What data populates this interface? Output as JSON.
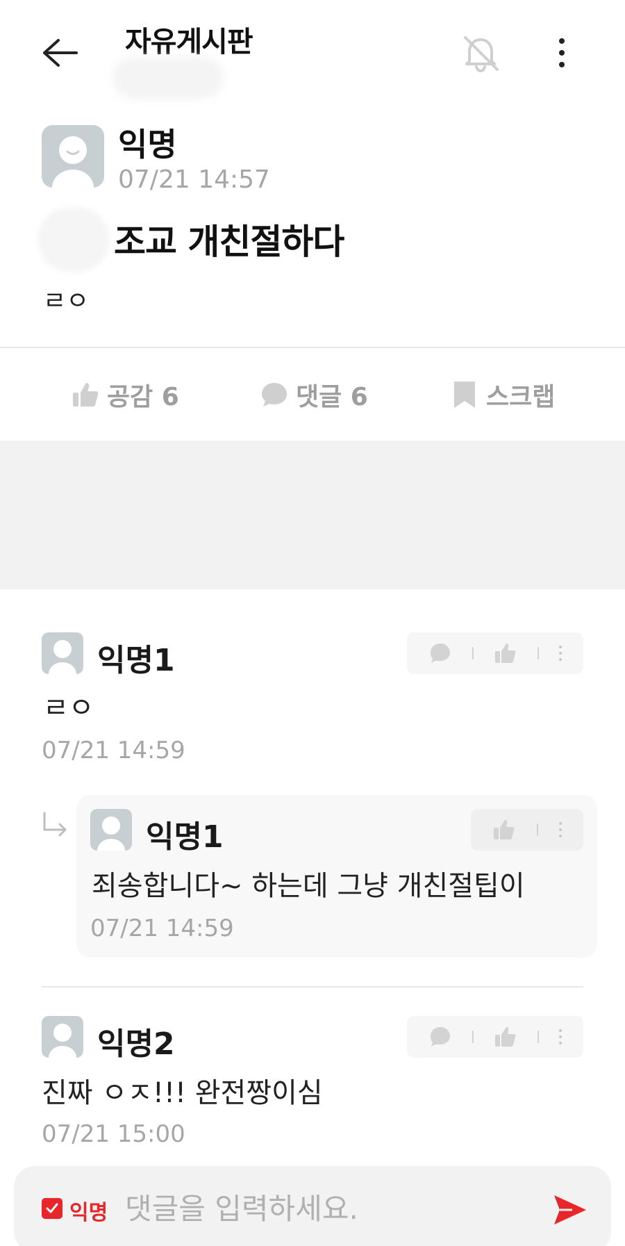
{
  "header": {
    "board_title": "자유게시판"
  },
  "post": {
    "author": "익명",
    "time": "07/21 14:57",
    "title": "조교 개친절하다",
    "body": "ㄹㅇ",
    "actions": {
      "like_label": "공감 6",
      "comment_label": "댓글 6",
      "scrap_label": "스크랩"
    }
  },
  "comments": [
    {
      "author": "익명1",
      "body": "ㄹㅇ",
      "time": "07/21 14:59"
    },
    {
      "author": "익명2",
      "body": "진짜 ㅇㅈ!!! 완전짱이심",
      "time": "07/21 15:00"
    }
  ],
  "replies": [
    {
      "author": "익명1",
      "body": "죄송합니다~ 하는데 그냥 개친절팁이",
      "time": "07/21 14:59"
    }
  ],
  "input_bar": {
    "anonymous_label": "익명",
    "placeholder": "댓글을 입력하세요."
  },
  "colors": {
    "accent": "#e8262a",
    "muted_text": "#a6a6a6",
    "avatar_bg": "#c8cfd3"
  }
}
